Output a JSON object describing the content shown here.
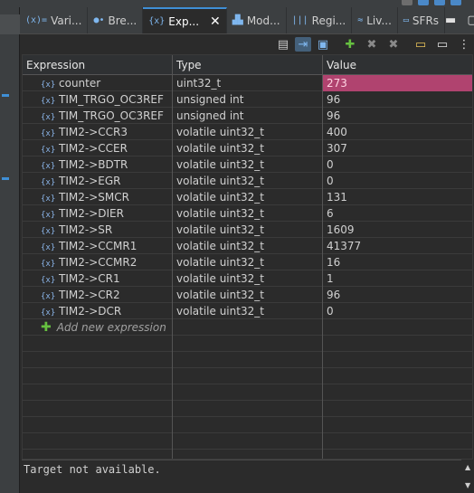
{
  "tabs": [
    {
      "icon": "(x)=",
      "label": "Vari...",
      "name": "tab-variables"
    },
    {
      "icon": "●•",
      "label": "Bre...",
      "name": "tab-breakpoints"
    },
    {
      "icon": "{x}",
      "label": "Exp...",
      "name": "tab-expressions",
      "active": true
    },
    {
      "icon": "▟▙",
      "label": "Mod...",
      "name": "tab-modules"
    },
    {
      "icon": "|||",
      "label": "Regi...",
      "name": "tab-registers"
    },
    {
      "icon": "≈",
      "label": "Liv...",
      "name": "tab-live"
    },
    {
      "icon": "▭",
      "label": "SFRs",
      "name": "tab-sfrs"
    }
  ],
  "window_buttons": {
    "minimize": "▬",
    "maximize": "▢"
  },
  "columns": {
    "expression": "Expression",
    "type": "Type",
    "value": "Value"
  },
  "rows": [
    {
      "expression": "counter",
      "type": "uint32_t",
      "value": "273",
      "changed": true
    },
    {
      "expression": "TIM_TRGO_OC3REF",
      "type": "unsigned int",
      "value": "96"
    },
    {
      "expression": "TIM_TRGO_OC3REF",
      "type": "unsigned int",
      "value": "96"
    },
    {
      "expression": "TIM2->CCR3",
      "type": "volatile uint32_t",
      "value": "400"
    },
    {
      "expression": "TIM2->CCER",
      "type": "volatile uint32_t",
      "value": "307"
    },
    {
      "expression": "TIM2->BDTR",
      "type": "volatile uint32_t",
      "value": "0"
    },
    {
      "expression": "TIM2->EGR",
      "type": "volatile uint32_t",
      "value": "0"
    },
    {
      "expression": "TIM2->SMCR",
      "type": "volatile uint32_t",
      "value": "131"
    },
    {
      "expression": "TIM2->DIER",
      "type": "volatile uint32_t",
      "value": "6"
    },
    {
      "expression": "TIM2->SR",
      "type": "volatile uint32_t",
      "value": "1609"
    },
    {
      "expression": "TIM2->CCMR1",
      "type": "volatile uint32_t",
      "value": "41377"
    },
    {
      "expression": "TIM2->CCMR2",
      "type": "volatile uint32_t",
      "value": "16"
    },
    {
      "expression": "TIM2->CR1",
      "type": "volatile uint32_t",
      "value": "1"
    },
    {
      "expression": "TIM2->CR2",
      "type": "volatile uint32_t",
      "value": "96"
    },
    {
      "expression": "TIM2->DCR",
      "type": "volatile uint32_t",
      "value": "0"
    }
  ],
  "add_expression_label": "Add new expression",
  "status_text": "Target not available.",
  "colors": {
    "changed_value_bg": "#b0436f",
    "accent": "#3f8fd6",
    "add_green": "#66c040"
  }
}
